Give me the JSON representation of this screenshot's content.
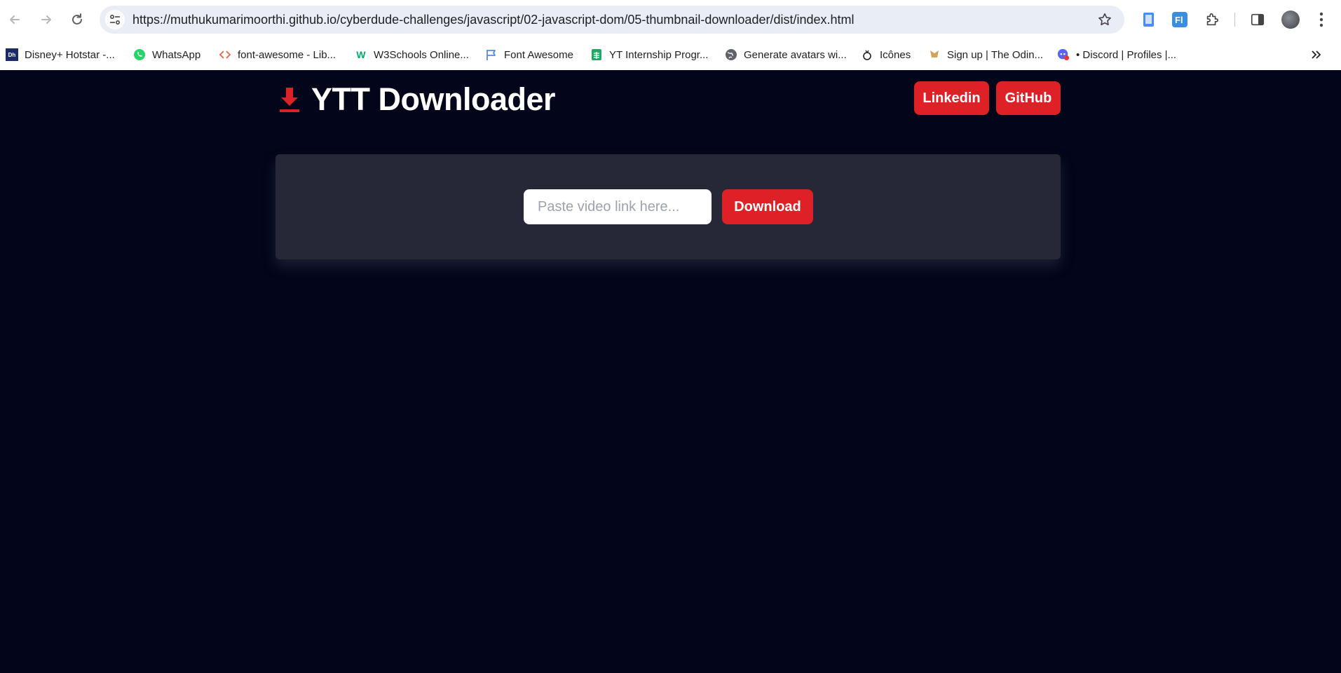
{
  "browser": {
    "url": "https://muthukumarimoorthi.github.io/cyberdude-challenges/javascript/02-javascript-dom/05-thumbnail-downloader/dist/index.html",
    "bookmarks": [
      {
        "label": "Disney+ Hotstar -...",
        "icon": "disney-hotstar-icon",
        "color": "#1a2b6b"
      },
      {
        "label": "WhatsApp",
        "icon": "whatsapp-icon",
        "color": "#25d366"
      },
      {
        "label": "font-awesome - Lib...",
        "icon": "code-brackets-icon",
        "color": "#e8673b"
      },
      {
        "label": "W3Schools Online...",
        "icon": "w3schools-icon",
        "color": "#04aa6d"
      },
      {
        "label": "Font Awesome",
        "icon": "flag-icon",
        "color": "#538dd7"
      },
      {
        "label": "YT Internship Progr...",
        "icon": "sheets-icon",
        "color": "#23a566"
      },
      {
        "label": "Generate avatars wi...",
        "icon": "globe-icon",
        "color": "#5f6368"
      },
      {
        "label": "Icônes",
        "icon": "icones-icon",
        "color": "#202124"
      },
      {
        "label": "Sign up | The Odin...",
        "icon": "odin-icon",
        "color": "#d4a35a"
      },
      {
        "label": "• Discord | Profiles |...",
        "icon": "discord-icon",
        "color": "#5865f2"
      }
    ]
  },
  "header": {
    "title": "YTT Downloader",
    "linkedin_label": "Linkedin",
    "github_label": "GitHub"
  },
  "form": {
    "placeholder": "Paste video link here...",
    "value": "",
    "download_label": "Download"
  },
  "colors": {
    "accent": "#dd2126",
    "background": "#03061a",
    "card": "#262838"
  }
}
